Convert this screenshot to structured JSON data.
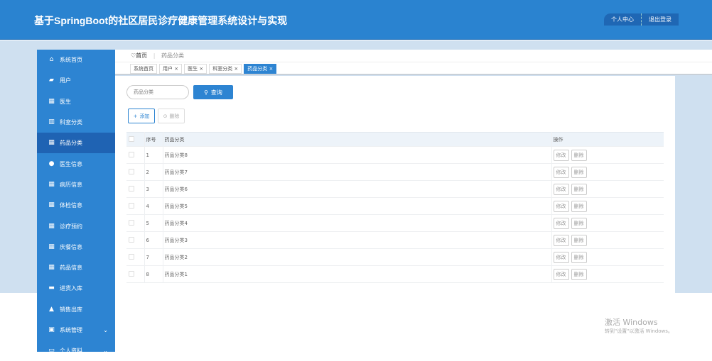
{
  "header": {
    "title": "基于SpringBoot的社区居民诊疗健康管理系统设计与实现",
    "user_center": "个人中心",
    "logout": "退出登录"
  },
  "sidebar": {
    "items": [
      {
        "label": "系统首页",
        "icon": "home-icon"
      },
      {
        "label": "用户",
        "icon": "briefcase-icon"
      },
      {
        "label": "医生",
        "icon": "grid-icon"
      },
      {
        "label": "科室分类",
        "icon": "book-icon"
      },
      {
        "label": "药品分类",
        "icon": "grid-icon",
        "active": true
      },
      {
        "label": "医生信息",
        "icon": "bulb-icon"
      },
      {
        "label": "病历信息",
        "icon": "grid-icon"
      },
      {
        "label": "体检信息",
        "icon": "grid-icon"
      },
      {
        "label": "诊疗预约",
        "icon": "grid-icon"
      },
      {
        "label": "庆餐信息",
        "icon": "grid-icon"
      },
      {
        "label": "药品信息",
        "icon": "grid-icon"
      },
      {
        "label": "进货入库",
        "icon": "monitor-icon"
      },
      {
        "label": "销售出库",
        "icon": "user-icon"
      },
      {
        "label": "系统管理",
        "icon": "chart-icon",
        "expandable": true
      },
      {
        "label": "个人资料",
        "icon": "card-icon",
        "expandable": true
      }
    ]
  },
  "breadcrumb": {
    "home": "首页",
    "separator": "|",
    "current": "药品分类"
  },
  "tabs": [
    {
      "label": "系统首页"
    },
    {
      "label": "用户 ×"
    },
    {
      "label": "医生 ×"
    },
    {
      "label": "科室分类 ×"
    },
    {
      "label": "药品分类 ×",
      "active": true
    }
  ],
  "search": {
    "placeholder": "药品分类",
    "value": "",
    "button": "查询"
  },
  "actions": {
    "add": "添加",
    "delete": "删除"
  },
  "table": {
    "headers": [
      "序号",
      "药品分类",
      "操作"
    ],
    "edit_label": "修改",
    "delete_label": "删除",
    "rows": [
      {
        "index": "1",
        "name": "药品分类8"
      },
      {
        "index": "2",
        "name": "药品分类7"
      },
      {
        "index": "3",
        "name": "药品分类6"
      },
      {
        "index": "4",
        "name": "药品分类5"
      },
      {
        "index": "5",
        "name": "药品分类4"
      },
      {
        "index": "6",
        "name": "药品分类3"
      },
      {
        "index": "7",
        "name": "药品分类2"
      },
      {
        "index": "8",
        "name": "药品分类1"
      }
    ]
  },
  "watermark": {
    "line1": "激活 Windows",
    "line2": "转到\"设置\"以激活 Windows。"
  },
  "colors": {
    "primary": "#2a83d0",
    "active": "#1f63b3",
    "band": "#cfe0f0"
  }
}
